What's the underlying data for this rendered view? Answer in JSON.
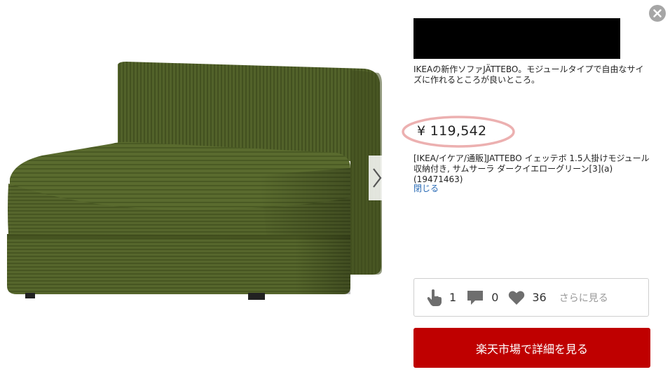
{
  "product": {
    "description": "IKEAの新作ソファJÄTTEBO。モジュールタイプで自由なサイズに作れるところが良いところ。",
    "price": "¥ 119,542",
    "name": "[IKEA/イケア/通販]JATTEBO イェッテボ 1.5人掛けモジュール 収納付き, サムサーラ ダークイエローグリーン[3](a)(19471463)",
    "close_label": "閉じる"
  },
  "stats": {
    "clips": "1",
    "comments": "0",
    "likes": "36",
    "see_more": "さらに見る"
  },
  "cta_label": "楽天市場で詳細を見る",
  "icons": [
    "close-icon",
    "chevron-right-icon",
    "hand-pointer-icon",
    "speech-bubble-icon",
    "heart-icon"
  ],
  "colors": {
    "cta": "#bf0000",
    "link": "#2a6bb5",
    "price_circle": "#e89a9a",
    "sofa": "#4f5e22"
  }
}
